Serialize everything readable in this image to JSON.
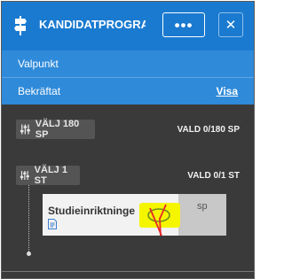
{
  "header": {
    "title": "KANDIDATPROGRA...",
    "icon": "signpost-icon",
    "more_label": "•••",
    "close_label": "✕"
  },
  "rows": {
    "valpunkt_label": "Valpunkt",
    "bekraftat_label": "Bekräftat",
    "visa_label": "Visa"
  },
  "sections": [
    {
      "tag_label": "VÄLJ 180 SP",
      "count_label": "VALD 0/180 SP",
      "icon": "sliders-icon"
    },
    {
      "tag_label": "VÄLJ 1 ST",
      "count_label": "VALD 0/1 ST",
      "icon": "sliders-icon"
    }
  ],
  "card": {
    "title": "Studieinriktninge",
    "unit": "sp",
    "doc_icon": "document-icon"
  },
  "colors": {
    "header_bg": "#1a7ad0",
    "row_bg": "#2f8ad9",
    "panel_bg": "#3a3a3a",
    "highlight": "#f6f500",
    "annotation_red": "#e8262a",
    "annotation_green": "#6a8f1a"
  }
}
